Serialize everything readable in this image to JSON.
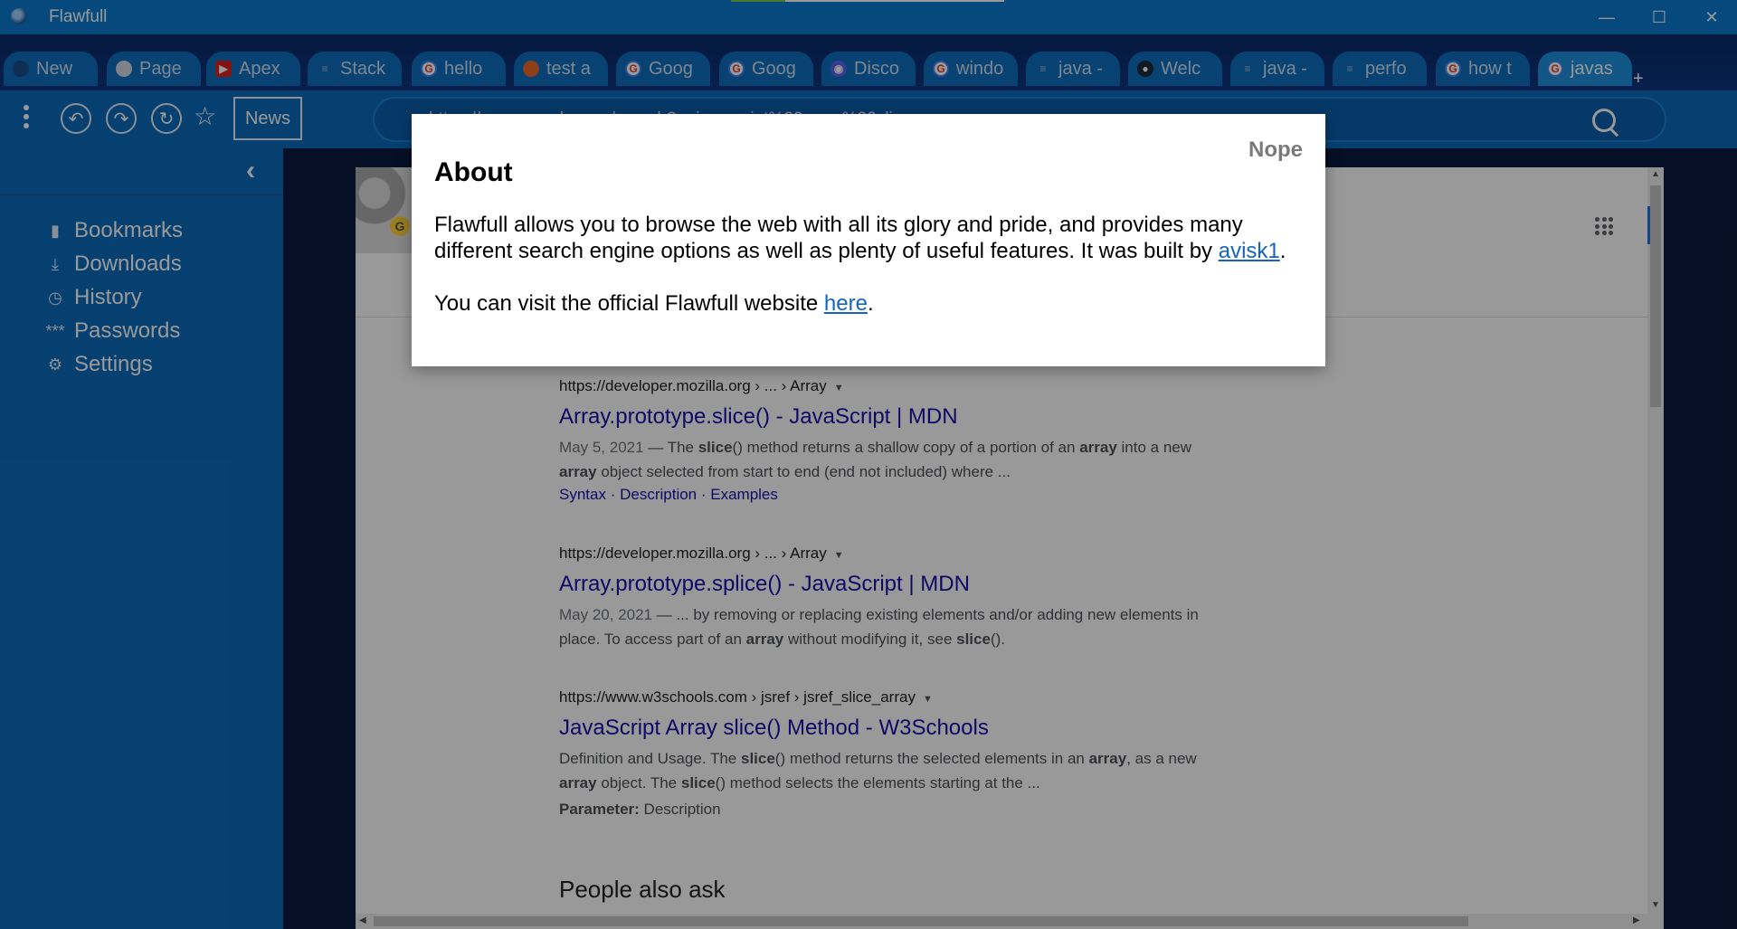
{
  "window": {
    "title": "Flawfull",
    "minimize": "—",
    "maximize": "☐",
    "close": "✕"
  },
  "tabs": [
    {
      "label": "New",
      "icon": "flawfull-icon"
    },
    {
      "label": "Page",
      "icon": "page-icon"
    },
    {
      "label": "Apex",
      "icon": "youtube-icon"
    },
    {
      "label": "Stack",
      "icon": "stackoverflow-icon"
    },
    {
      "label": "hello",
      "icon": "google-icon"
    },
    {
      "label": "test a",
      "icon": "firefox-icon"
    },
    {
      "label": "Goog",
      "icon": "google-icon"
    },
    {
      "label": "Goog",
      "icon": "google-icon"
    },
    {
      "label": "Disco",
      "icon": "discord-icon"
    },
    {
      "label": "windo",
      "icon": "google-icon"
    },
    {
      "label": "java -",
      "icon": "stackoverflow-icon"
    },
    {
      "label": "Welc",
      "icon": "steam-icon"
    },
    {
      "label": "java -",
      "icon": "stackoverflow-icon"
    },
    {
      "label": "perfo",
      "icon": "stackoverflow-icon"
    },
    {
      "label": "how t",
      "icon": "google-icon"
    },
    {
      "label": "javas",
      "icon": "google-icon"
    }
  ],
  "new_tab": "+",
  "toolbar": {
    "news": "News",
    "url": "https://www.google.com/search?q=javascript%20array%20slice"
  },
  "sidebar": {
    "items": [
      {
        "label": "Bookmarks",
        "icon": "bookmark-icon"
      },
      {
        "label": "Downloads",
        "icon": "download-icon"
      },
      {
        "label": "History",
        "icon": "history-icon"
      },
      {
        "label": "Passwords",
        "icon": "password-icon"
      },
      {
        "label": "Settings",
        "icon": "gear-icon"
      }
    ]
  },
  "results": [
    {
      "cite": "https://developer.mozilla.org › ... › Array",
      "title": "Array.prototype.slice() - JavaScript | MDN",
      "date": "May 5, 2021",
      "snippet1_a": " — The ",
      "b1": "slice",
      "snippet1_b": "() method returns a shallow copy of a portion of an ",
      "b2": "array",
      "snippet1_c": " into a new",
      "b3": "array",
      "snippet2": " object selected from start to end (end not included) where ...",
      "links": [
        "Syntax",
        "Description",
        "Examples"
      ]
    },
    {
      "cite": "https://developer.mozilla.org › ... › Array",
      "title": "Array.prototype.splice() - JavaScript | MDN",
      "date": "May 20, 2021",
      "snippet1": " — ... by removing or replacing existing elements and/or adding new elements in",
      "snippet2_a": "place. To access part of an ",
      "b1": "array",
      "snippet2_b": " without modifying it, see ",
      "b2": "slice",
      "snippet2_c": "()."
    },
    {
      "cite": "https://www.w3schools.com › jsref › jsref_slice_array",
      "title": "JavaScript Array slice() Method - W3Schools",
      "snippet1_a": "Definition and Usage. The ",
      "b1": "slice",
      "snippet1_b": "() method returns the selected elements in an ",
      "b2": "array",
      "snippet1_c": ", as a new",
      "b3": "array",
      "snippet2_a": " object. The ",
      "b4": "slice",
      "snippet2_b": "() method selects the elements starting at the ...",
      "param_label": "Parameter:",
      "param_value": " Description"
    }
  ],
  "people_also_ask": "People also ask",
  "dialog": {
    "close_label": "Nope",
    "title": "About",
    "body_1": "Flawfull allows you to browse the web with all its glory and pride, and provides many different search engine options as well as plenty of useful features. It was built by ",
    "author_link": "avisk1",
    "body_1_end": ".",
    "body_2": "You can visit the official Flawfull website ",
    "site_link": "here",
    "body_2_end": "."
  }
}
